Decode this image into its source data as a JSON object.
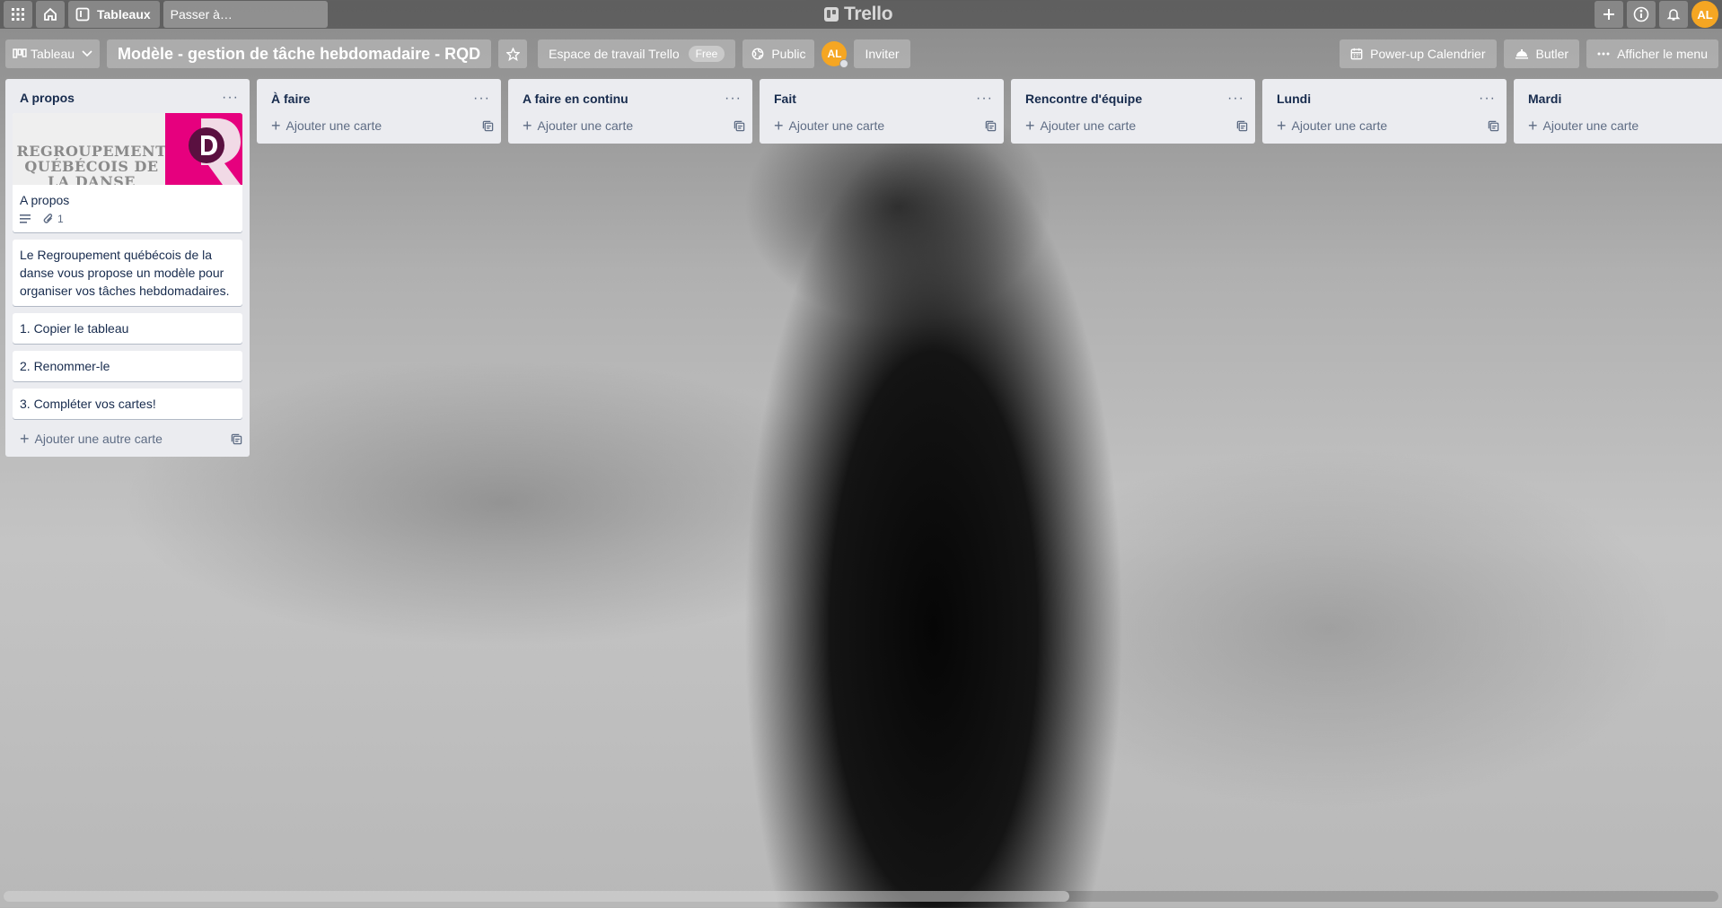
{
  "header": {
    "boards_label": "Tableaux",
    "search_placeholder": "Passer à…",
    "logo_text": "Trello",
    "user_initials": "AL"
  },
  "board": {
    "view_label": "Tableau",
    "title": "Modèle - gestion de tâche hebdomadaire - RQD",
    "workspace_label": "Espace de travail Trello",
    "workspace_badge": "Free",
    "visibility_label": "Public",
    "member_initials": "AL",
    "invite_label": "Inviter",
    "calendar_label": "Power-up Calendrier",
    "butler_label": "Butler",
    "menu_label": "Afficher le menu"
  },
  "lists": [
    {
      "title": "A propos",
      "cover_text": "REGROUPEMENT QUÉBÉCOIS DE LA DANSE",
      "cards": [
        {
          "text": "A propos",
          "attachments": "1"
        },
        {
          "text": "Le Regroupement québécois de la danse vous propose un modèle pour organiser vos tâches hebdomadaires."
        },
        {
          "text": "1. Copier le tableau"
        },
        {
          "text": "2. Renommer-le"
        },
        {
          "text": "3. Compléter vos cartes!"
        }
      ],
      "add_label": "Ajouter une autre carte"
    },
    {
      "title": "À faire",
      "add_label": "Ajouter une carte"
    },
    {
      "title": "A faire en continu",
      "add_label": "Ajouter une carte"
    },
    {
      "title": "Fait",
      "add_label": "Ajouter une carte"
    },
    {
      "title": "Rencontre d'équipe",
      "add_label": "Ajouter une carte"
    },
    {
      "title": "Lundi",
      "add_label": "Ajouter une carte"
    },
    {
      "title": "Mardi",
      "add_label": "Ajouter une carte"
    }
  ],
  "colors": {
    "avatar": "#f5a623",
    "list_bg": "#ebecf0",
    "rqd_pink": "#e6007e"
  }
}
